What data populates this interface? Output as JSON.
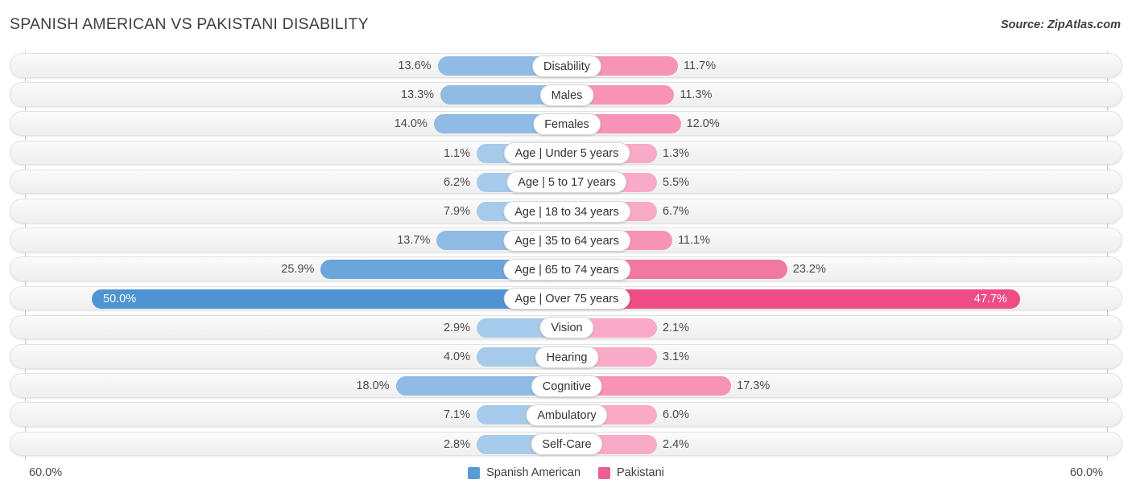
{
  "header": {
    "title": "SPANISH AMERICAN VS PAKISTANI DISABILITY",
    "source": "Source: ZipAtlas.com"
  },
  "axis": {
    "left_tick": "60.0%",
    "right_tick": "60.0%",
    "max": 60.0
  },
  "legend": {
    "items": [
      {
        "label": "Spanish American",
        "color": "#5B9BD5"
      },
      {
        "label": "Pakistani",
        "color": "#EF5E92"
      }
    ]
  },
  "colors": {
    "left_light": "#A6CAEA",
    "left_mid": "#8FBBE4",
    "left_strong": "#6AA5DB",
    "left_max": "#4E93D2",
    "right_light": "#F8AAC6",
    "right_mid": "#F693B6",
    "right_strong": "#F278A4",
    "right_max": "#ED4C84",
    "track": "#F4F4F4",
    "axis": "#c9c9c9"
  },
  "chart_data": {
    "type": "bar",
    "title": "SPANISH AMERICAN VS PAKISTANI DISABILITY",
    "orientation": "horizontal-diverging",
    "xlabel": "",
    "ylabel": "",
    "xlim": [
      60.0,
      60.0
    ],
    "grid": false,
    "legend_position": "bottom-center",
    "categories": [
      "Disability",
      "Males",
      "Females",
      "Age | Under 5 years",
      "Age | 5 to 17 years",
      "Age | 18 to 34 years",
      "Age | 35 to 64 years",
      "Age | 65 to 74 years",
      "Age | Over 75 years",
      "Vision",
      "Hearing",
      "Cognitive",
      "Ambulatory",
      "Self-Care"
    ],
    "series": [
      {
        "name": "Spanish American",
        "color": "#5B9BD5",
        "side": "left",
        "values": [
          13.6,
          13.3,
          14.0,
          1.1,
          6.2,
          7.9,
          13.7,
          25.9,
          50.0,
          2.9,
          4.0,
          18.0,
          7.1,
          2.8
        ]
      },
      {
        "name": "Pakistani",
        "color": "#EF5E92",
        "side": "right",
        "values": [
          11.7,
          11.3,
          12.0,
          1.3,
          5.5,
          6.7,
          11.1,
          23.2,
          47.7,
          2.1,
          3.1,
          17.3,
          6.0,
          2.4
        ]
      }
    ],
    "left_labels": [
      "13.6%",
      "13.3%",
      "14.0%",
      "1.1%",
      "6.2%",
      "7.9%",
      "13.7%",
      "25.9%",
      "50.0%",
      "2.9%",
      "4.0%",
      "18.0%",
      "7.1%",
      "2.8%"
    ],
    "right_labels": [
      "11.7%",
      "11.3%",
      "12.0%",
      "1.3%",
      "5.5%",
      "6.7%",
      "11.1%",
      "23.2%",
      "47.7%",
      "2.1%",
      "3.1%",
      "17.3%",
      "6.0%",
      "2.4%"
    ]
  }
}
